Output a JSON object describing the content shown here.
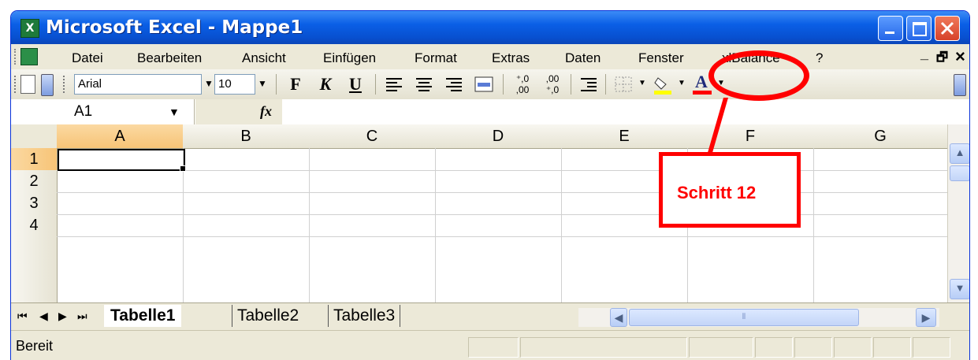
{
  "window": {
    "title": "Microsoft Excel - Mappe1",
    "app_icon": "excel-icon",
    "controls": [
      "minimize-icon",
      "maximize-icon",
      "close-icon"
    ]
  },
  "menubar": {
    "items": [
      {
        "id": "datei",
        "label": "Datei"
      },
      {
        "id": "bearbeiten",
        "label": "Bearbeiten"
      },
      {
        "id": "ansicht",
        "label": "Ansicht"
      },
      {
        "id": "einfuegen",
        "label": "Einfügen"
      },
      {
        "id": "format",
        "label": "Format"
      },
      {
        "id": "extras",
        "label": "Extras"
      },
      {
        "id": "daten",
        "label": "Daten"
      },
      {
        "id": "fenster",
        "label": "Fenster"
      },
      {
        "id": "xlbalance",
        "label": "xlBalance"
      },
      {
        "id": "help",
        "label": "?"
      }
    ],
    "mdi_minimize": "_",
    "mdi_restore": "🗗",
    "mdi_close": "×"
  },
  "toolbar": {
    "font_name": "Arial",
    "font_size": "10",
    "bold": "F",
    "italic": "K",
    "underline": "U",
    "align_left_icon": "align-left-icon",
    "align_center_icon": "align-center-icon",
    "align_right_icon": "align-right-icon",
    "merge_icon": "merge-center-icon",
    "increase_decimal_icon": "increase-decimal-icon",
    "decrease_decimal_icon": "decrease-decimal-icon",
    "indent_icon": "indent-icon",
    "borders_icon": "borders-icon",
    "fill_color": "#FFFF00",
    "font_color_bar": "#FF0000",
    "font_color_letter": "A"
  },
  "formula_bar": {
    "name_box": "A1",
    "fx": "fx",
    "content": ""
  },
  "sheet": {
    "columns": [
      "A",
      "B",
      "C",
      "D",
      "E",
      "F",
      "G"
    ],
    "rows": [
      "1",
      "2",
      "3",
      "4"
    ],
    "active_cell": "A1"
  },
  "tabs": [
    "Tabelle1",
    "Tabelle2",
    "Tabelle3"
  ],
  "active_tab": "Tabelle1",
  "status": "Bereit",
  "annotation": {
    "label": "Schritt 12",
    "color": "#FF0000"
  }
}
